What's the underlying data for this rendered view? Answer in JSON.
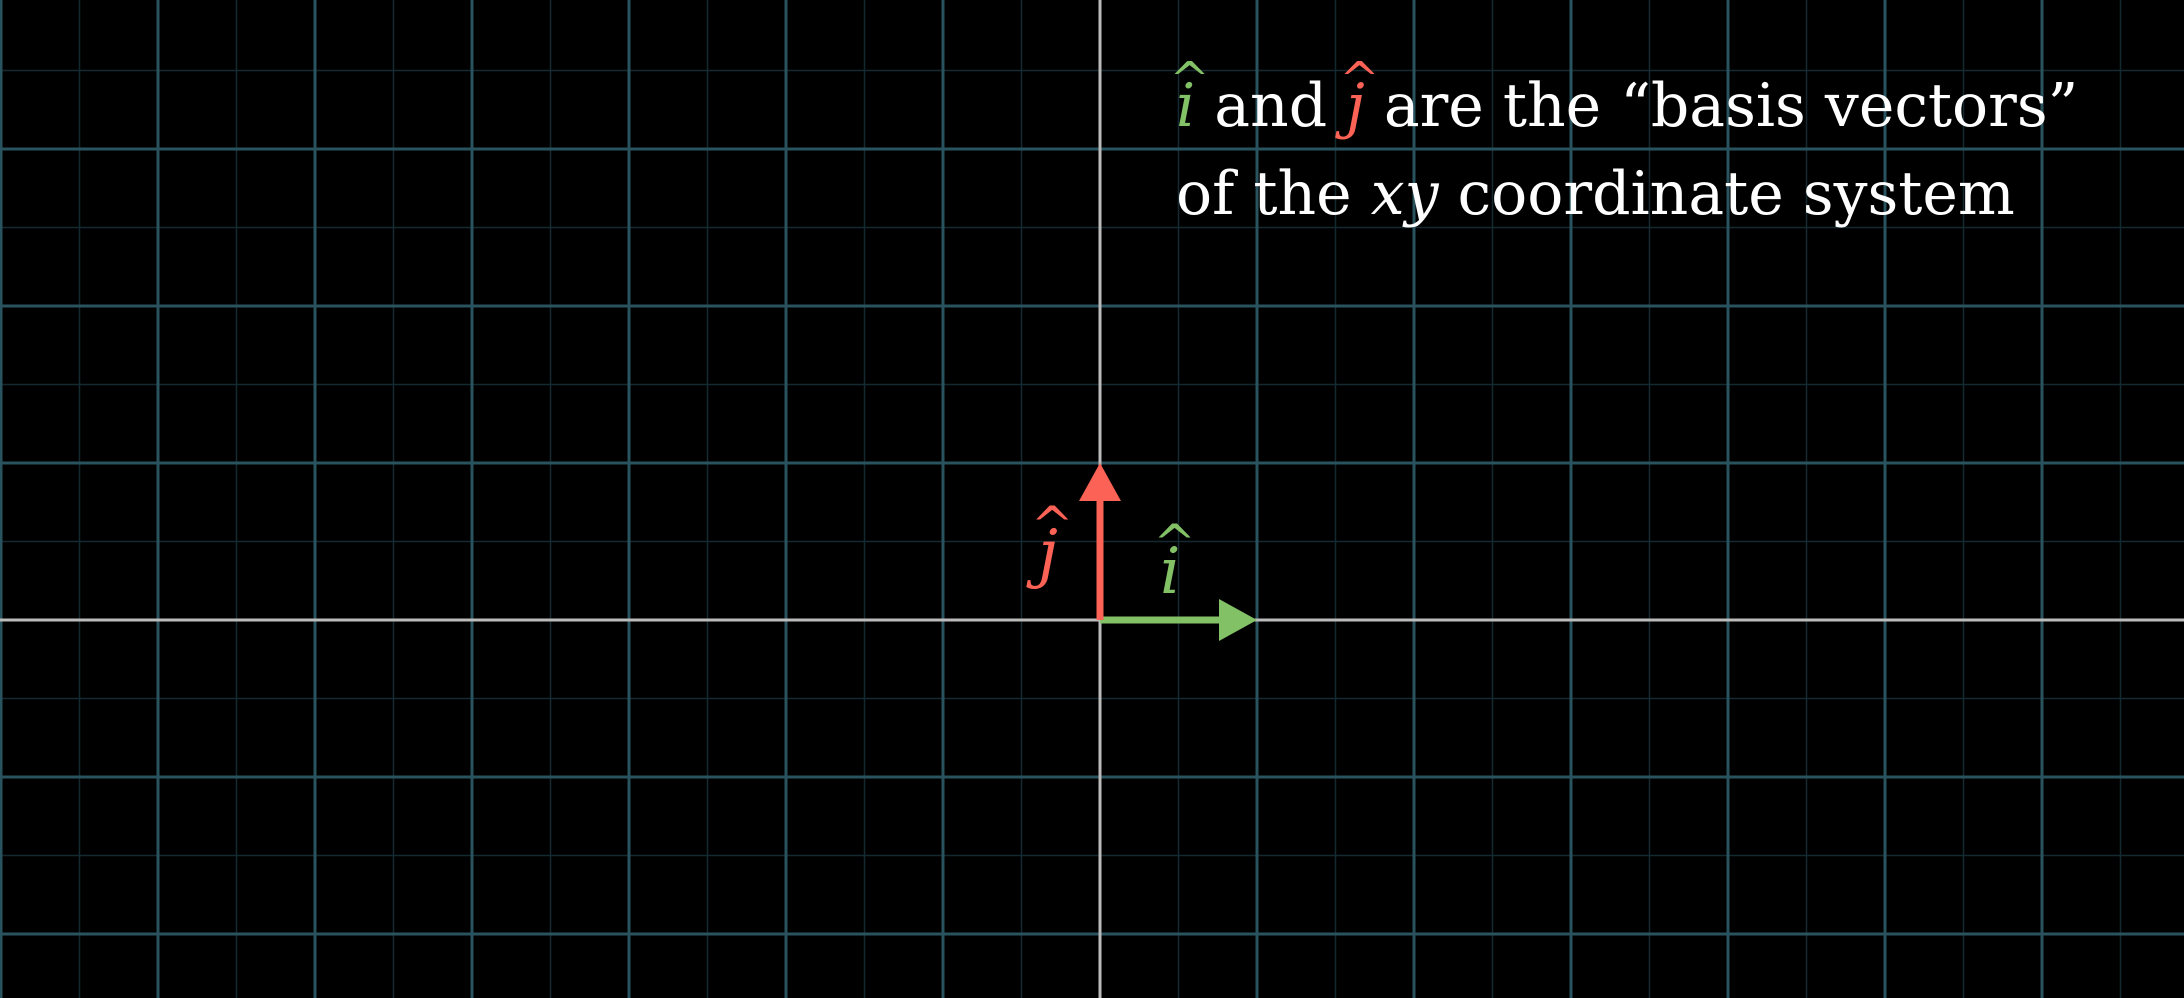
{
  "caption": {
    "line1": {
      "i_hat": "i",
      "middle": " and ",
      "j_hat": "j",
      "rest": " are the “basis vectors”"
    },
    "line2": {
      "pre": "of the ",
      "var": "xy",
      "post": " coordinate system"
    }
  },
  "vectors": {
    "i_hat": {
      "label": "i",
      "coords": [
        1,
        0
      ],
      "color": "#83c167"
    },
    "j_hat": {
      "label": "j",
      "coords": [
        0,
        1
      ],
      "color": "#fc6255"
    }
  },
  "colors": {
    "background": "#000000",
    "grid_major": "#29535e",
    "grid_minor": "#152a30",
    "axes": "#bbbbbb"
  }
}
